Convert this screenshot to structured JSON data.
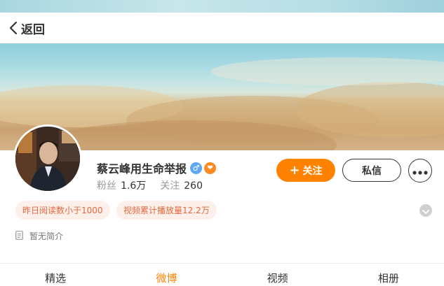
{
  "nav": {
    "back_label": "返回"
  },
  "profile": {
    "name": "蔡云峰用生命举报",
    "gender_symbol": "♂",
    "vip_symbol": "❤",
    "stats": [
      {
        "label": "粉丝",
        "value": "1.6万"
      },
      {
        "label": "关注",
        "value": "260"
      }
    ],
    "bio": "暂无简介"
  },
  "actions": {
    "follow_label": "关注",
    "message_label": "私信"
  },
  "tags": [
    "昨日阅读数小于1000",
    "视频累计播放量12.2万"
  ],
  "tabs": [
    {
      "label": "精选",
      "active": false
    },
    {
      "label": "微博",
      "active": true
    },
    {
      "label": "视频",
      "active": false
    },
    {
      "label": "相册",
      "active": false
    }
  ],
  "colors": {
    "accent": "#ff8200",
    "tag_text": "#e8663a",
    "tag_bg": "#fdf0ea",
    "gender_badge": "#5fa9f2"
  },
  "icons": [
    "back-chevron-icon",
    "male-icon",
    "vip-heart-icon",
    "plus-icon",
    "more-dots-icon",
    "chevron-down-icon",
    "document-icon"
  ]
}
